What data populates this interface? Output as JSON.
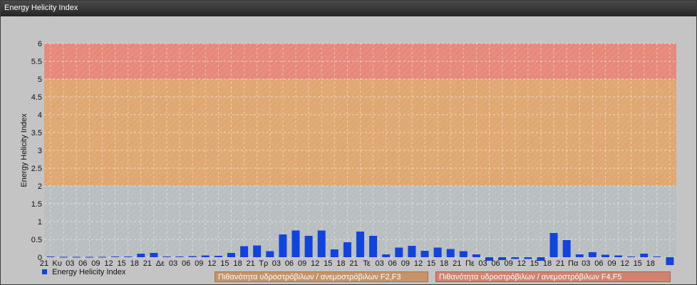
{
  "window": {
    "title": "Energy Helicity Index"
  },
  "colors": {
    "bar": "#1144dd",
    "band_low": "#b9bec0",
    "band_mid": "#dfa772",
    "band_high": "#e6897a",
    "plot_bg": "#c4c4c4"
  },
  "legend": {
    "series_label": "Energy Helicity Index",
    "bands": [
      "Πιθανότητα υδροστρόβιλων / ανεμοστρόβιλων F2,F3",
      "Πιθανότητα υδροστρόβιλων / ανεμοστρόβιλων F4,F5"
    ]
  },
  "chart_data": {
    "type": "bar",
    "title": "",
    "xlabel": "",
    "ylabel": "Energy Helicity Index",
    "ylim": [
      0,
      6
    ],
    "yticks": [
      "0",
      "0.5",
      "1",
      "1.5",
      "2",
      "2.5",
      "3",
      "3.5",
      "4",
      "4.5",
      "5",
      "5.5",
      "6"
    ],
    "grid": true,
    "bands": [
      {
        "from": 0,
        "to": 2,
        "label": ""
      },
      {
        "from": 2,
        "to": 5,
        "label": "Πιθανότητα υδροστρόβιλων / ανεμοστρόβιλων F2,F3"
      },
      {
        "from": 5,
        "to": 6,
        "label": "Πιθανότητα υδροστρόβιλων / ανεμοστρόβιλων F4,F5"
      }
    ],
    "categories": [
      "21",
      "Κυ",
      "03",
      "06",
      "09",
      "12",
      "15",
      "18",
      "21",
      "Δε",
      "03",
      "06",
      "09",
      "12",
      "15",
      "18",
      "21",
      "Τρ",
      "03",
      "06",
      "09",
      "12",
      "15",
      "18",
      "21",
      "Τε",
      "03",
      "06",
      "09",
      "12",
      "15",
      "18",
      "21",
      "Πε",
      "03",
      "06",
      "09",
      "12",
      "15",
      "18",
      "21",
      "Πα",
      "03",
      "06",
      "09",
      "12",
      "15",
      "18"
    ],
    "series": [
      {
        "name": "Energy Helicity Index",
        "values": [
          0.02,
          0.01,
          0.01,
          0.01,
          0.01,
          0.02,
          0.02,
          0.1,
          0.12,
          0.02,
          0.02,
          0.03,
          0.05,
          0.04,
          0.12,
          0.31,
          0.33,
          0.17,
          0.64,
          0.75,
          0.6,
          0.75,
          0.22,
          0.42,
          0.72,
          0.6,
          0.08,
          0.27,
          0.32,
          0.18,
          0.27,
          0.23,
          0.17,
          0.08,
          -0.1,
          -0.08,
          -0.05,
          -0.05,
          -0.1,
          0.68,
          0.48,
          0.08,
          0.14,
          0.07,
          0.05,
          0.02,
          0.1,
          0.02,
          -0.22
        ]
      }
    ]
  }
}
